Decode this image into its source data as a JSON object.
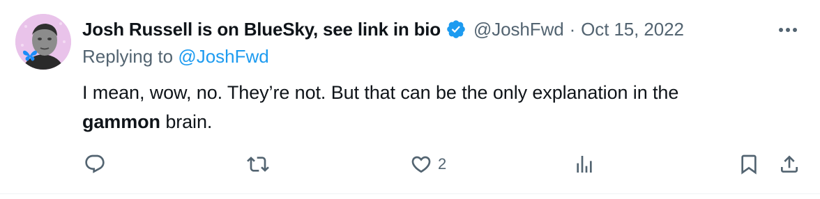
{
  "tweet": {
    "author_name": "Josh Russell is on BlueSky, see link in bio",
    "handle": "@JoshFwd",
    "separator": "·",
    "date": "Oct 15, 2022",
    "replying_prefix": "Replying to",
    "replying_handle": "@JoshFwd",
    "text_part1": "I mean, wow, no. They’re not. But that can be the only explanation in the",
    "text_bold": "gammon",
    "text_part2": " brain."
  },
  "actions": {
    "reply_count": "",
    "retweet_count": "",
    "like_count": "2",
    "views_count": ""
  },
  "colors": {
    "text": "#0f1419",
    "secondary": "#536471",
    "link": "#1d9bf0",
    "verified": "#1d9bf0",
    "avatar_bg": "#e9c3ea"
  },
  "icons": [
    "verified-badge-icon",
    "more-icon",
    "reply-icon",
    "retweet-icon",
    "like-icon",
    "views-icon",
    "bookmark-icon",
    "share-icon",
    "butterfly-icon"
  ]
}
